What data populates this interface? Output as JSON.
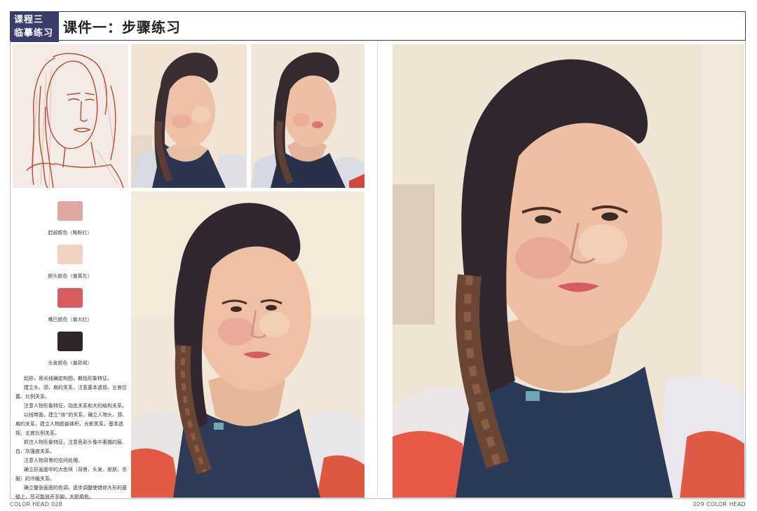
{
  "header": {
    "badge_line1": "课程三",
    "badge_line2": "临摹练习",
    "title": "课件一：步骤练习"
  },
  "swatches": [
    {
      "label": "脸部颜色（略粉红）",
      "color": "#e0a7a3"
    },
    {
      "label": "额头颜色（偏黄灰）",
      "color": "#f1d3c2"
    },
    {
      "label": "嘴巴颜色（偏大红）",
      "color": "#d95c5f"
    },
    {
      "label": "头发颜色（偏熟褐）",
      "color": "#302528"
    }
  ],
  "steps": [
    "起形，用长线确定构图，概括形象特征。",
    "建立头、颈、肩的关系，注意基本透视、五官位置、比例关系。",
    "注意人物形象特征，动态关系和大的结构关系。",
    "以线带面，建立“体”的关系，确立人物头、颈、肩的关系，建立人物脸部体积、光影关系，基本透视、五官比例关系。",
    "抓住人物形象特征，注意色彩头像中素描的层、白、灰强度关系。",
    "注意人物背景的空间处理。",
    "确立好画面中的大色块（背景、头发、皮肤、衣服）的冷暖关系。",
    "确立整张画面的色调，逐步调整使错综大形的基础上，尽可能放开手脚，大胆用色。"
  ],
  "footer": {
    "left": "COLOR  HEAD    028",
    "right": "029 COLOR  HEAD"
  },
  "colors": {
    "header_badge_bg": "#3a3d6b",
    "sketch_line": "#b8492f"
  }
}
